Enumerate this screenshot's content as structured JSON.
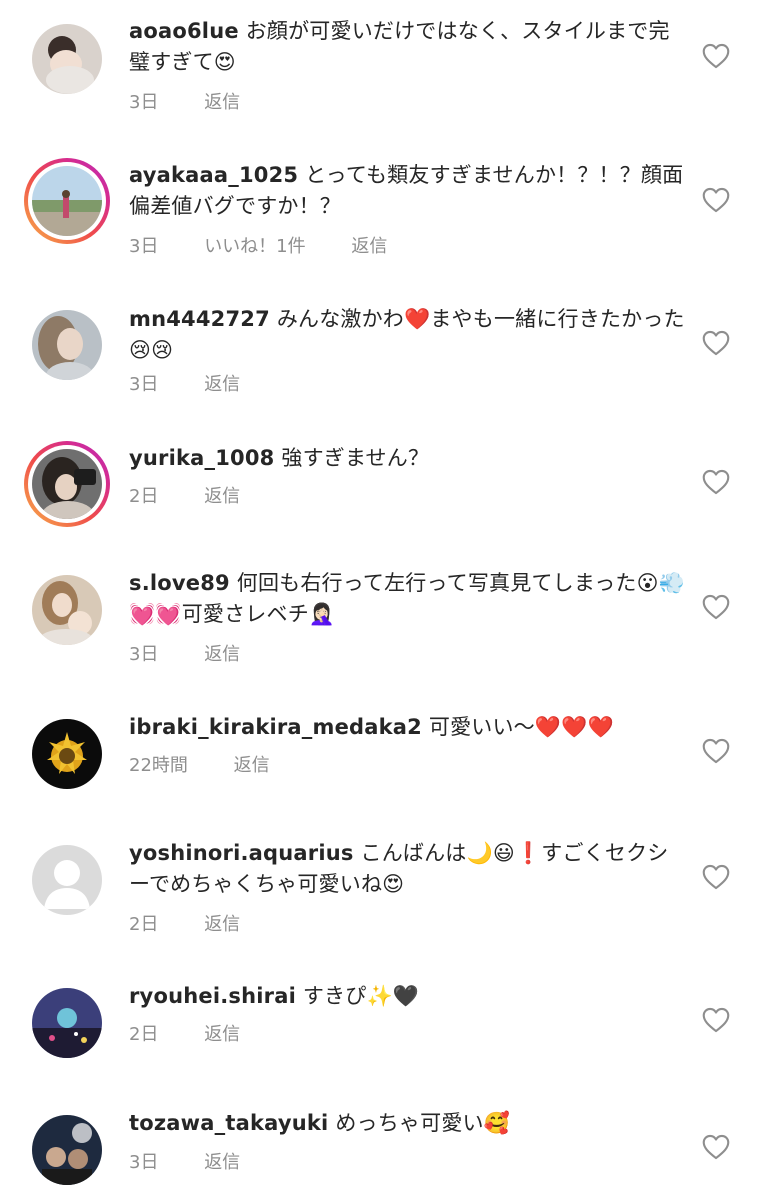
{
  "comments": [
    {
      "username": "aoao6lue",
      "text": "お顔が可愛いだけではなく、スタイルまで完璧すぎて😍",
      "time": "3日",
      "likes": "",
      "reply": "返信",
      "story_ring": false
    },
    {
      "username": "ayakaaa_1025",
      "text": "とっても類友すぎませんか！？！？顔面偏差値バグですか！？",
      "time": "3日",
      "likes": "いいね！1件",
      "reply": "返信",
      "story_ring": true
    },
    {
      "username": "mn4442727",
      "text": "みんな激かわ❤️まやも一緒に行きたかった😢😢",
      "time": "3日",
      "likes": "",
      "reply": "返信",
      "story_ring": false
    },
    {
      "username": "yurika_1008",
      "text": "強すぎません？",
      "time": "2日",
      "likes": "",
      "reply": "返信",
      "story_ring": true
    },
    {
      "username": "s.love89",
      "text": "何回も右行って左行って写真見てしまった😮💨💓💓可愛さレベチ🤦🏻‍♀️",
      "time": "3日",
      "likes": "",
      "reply": "返信",
      "story_ring": false
    },
    {
      "username": "ibraki_kirakira_medaka2",
      "text": "可愛いい〜❤️❤️❤️",
      "time": "22時間",
      "likes": "",
      "reply": "返信",
      "story_ring": false
    },
    {
      "username": "yoshinori.aquarius",
      "text": "こんばんは🌙😃❗️すごくセクシーでめちゃくちゃ可愛いね😍",
      "time": "2日",
      "likes": "",
      "reply": "返信",
      "story_ring": false
    },
    {
      "username": "ryouhei.shirai",
      "text": "すきぴ✨🖤",
      "time": "2日",
      "likes": "",
      "reply": "返信",
      "story_ring": false
    },
    {
      "username": "tozawa_takayuki",
      "text": "めっちゃ可愛い🥰",
      "time": "3日",
      "likes": "",
      "reply": "返信",
      "story_ring": false
    }
  ],
  "icons": {
    "like": "heart-outline-icon"
  },
  "colors": {
    "text": "#262626",
    "meta": "#8e8e8e",
    "heart_outline": "#8e8e8e"
  }
}
